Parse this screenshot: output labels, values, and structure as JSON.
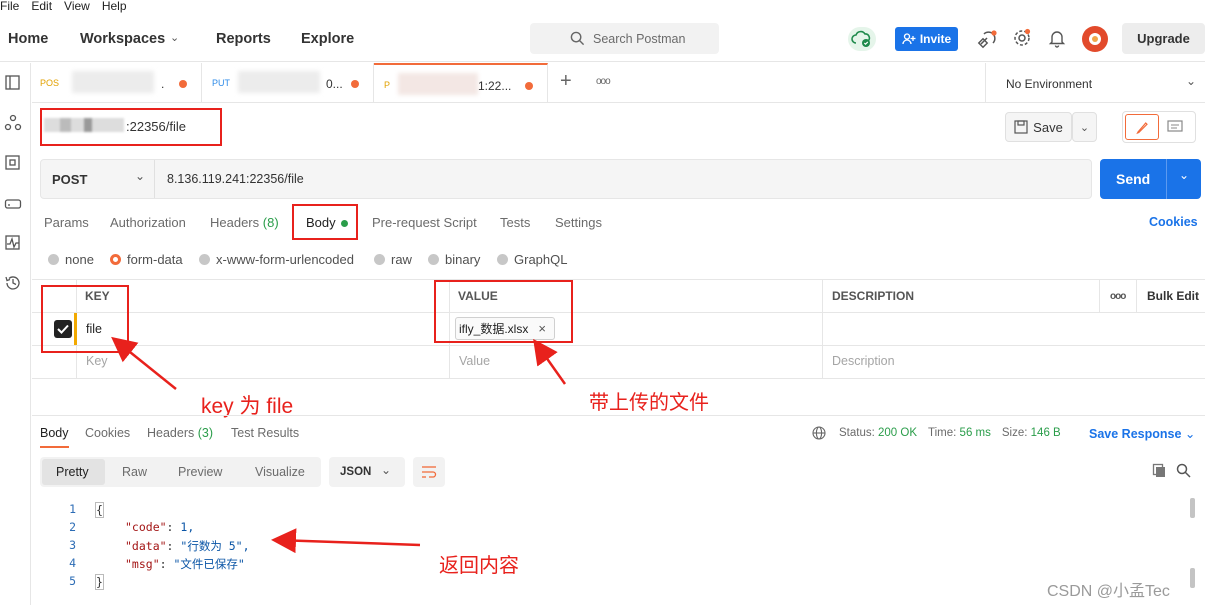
{
  "menubar": [
    "File",
    "Edit",
    "View",
    "Help"
  ],
  "header": {
    "nav": {
      "home": "Home",
      "workspaces": "Workspaces",
      "reports": "Reports",
      "explore": "Explore"
    },
    "search_placeholder": "Search Postman",
    "invite": "Invite",
    "upgrade": "Upgrade"
  },
  "tabs": [
    {
      "method": "POS",
      "method_color": "#e2a100",
      "title_suffix": "."
    },
    {
      "method": "PUT",
      "method_color": "#2e8be8",
      "title_suffix": "0..."
    },
    {
      "method": "P",
      "method_color": "#e2a100",
      "title_suffix": "1:22..."
    }
  ],
  "more_tabs": "ooo",
  "environment": "No Environment",
  "request": {
    "name_suffix": ":22356/file",
    "save": "Save",
    "method": "POST",
    "url": "8.136.119.241:22356/file",
    "send": "Send"
  },
  "request_tabs": {
    "params": "Params",
    "authorization": "Authorization",
    "headers": "Headers",
    "headers_count": "(8)",
    "body": "Body",
    "prerequest": "Pre-request Script",
    "tests": "Tests",
    "settings": "Settings",
    "cookies": "Cookies"
  },
  "body_types": [
    "none",
    "form-data",
    "x-www-form-urlencoded",
    "raw",
    "binary",
    "GraphQL"
  ],
  "body_selected": "form-data",
  "table": {
    "headers": {
      "key": "KEY",
      "value": "VALUE",
      "description": "DESCRIPTION",
      "more": "ooo",
      "bulk": "Bulk Edit"
    },
    "row": {
      "key": "file",
      "value": "ifly_数据.xlsx",
      "checked": true
    },
    "placeholders": {
      "key": "Key",
      "value": "Value",
      "description": "Description"
    }
  },
  "annotations": {
    "key_note": "key 为 file",
    "value_note": "带上传的文件",
    "response_note": "返回内容"
  },
  "response": {
    "tabs": {
      "body": "Body",
      "cookies": "Cookies",
      "headers": "Headers",
      "headers_count": "(3)",
      "tests": "Test Results"
    },
    "status_label": "Status:",
    "status": "200 OK",
    "time_label": "Time:",
    "time": "56 ms",
    "size_label": "Size:",
    "size": "146 B",
    "save_response": "Save Response",
    "views": [
      "Pretty",
      "Raw",
      "Preview",
      "Visualize"
    ],
    "format": "JSON",
    "line_numbers": [
      "1",
      "2",
      "3",
      "4",
      "5"
    ],
    "json_lines": {
      "open": "{",
      "code_key": "\"code\"",
      "code_val": "1,",
      "data_key": "\"data\"",
      "data_val": "\"行数为 5\",",
      "msg_key": "\"msg\"",
      "msg_val": "\"文件已保存\"",
      "close": "}"
    }
  },
  "watermark": "CSDN @小孟Tec",
  "colors": {
    "accent": "#1a73e8",
    "orange": "#f26b3a",
    "red_annotation": "#e8211c",
    "green": "#2a9d4a"
  }
}
